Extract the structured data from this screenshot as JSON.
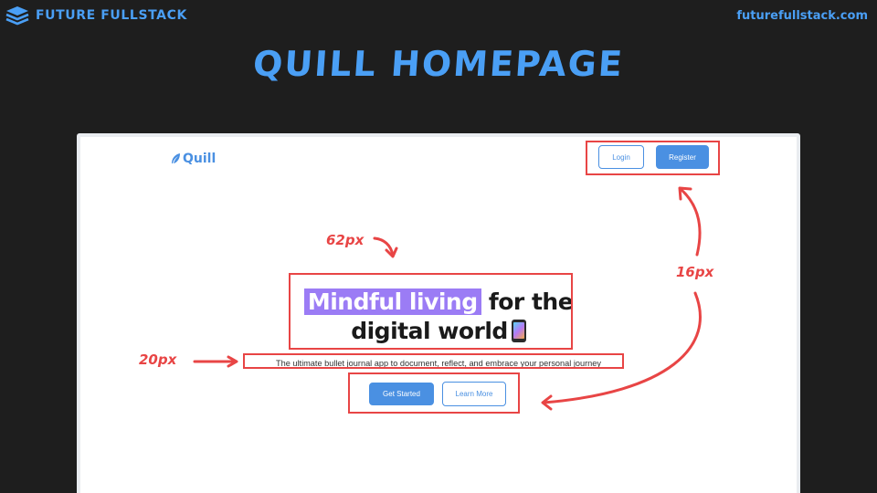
{
  "header": {
    "brand": "FUTURE FULLSTACK",
    "url": "futurefullstack.com"
  },
  "slide_title": "QUILL HOMEPAGE",
  "mockup": {
    "logo": "Quill",
    "nav": {
      "login": "Login",
      "register": "Register"
    },
    "hero": {
      "title_highlight": "Mindful living",
      "title_rest": "for the",
      "title_line2": "digital world",
      "subtitle": "The ultimate bullet journal app to document, reflect, and embrace your personal journey",
      "primary_button": "Get Started",
      "secondary_button": "Learn More"
    }
  },
  "annotations": {
    "title_size": "62px",
    "subtitle_size": "20px",
    "button_size": "16px",
    "color": "#e84545"
  },
  "colors": {
    "accent": "#4a9ff5",
    "button": "#4a90e2",
    "highlight": "#9b7cf5",
    "background": "#1e1e1e"
  }
}
